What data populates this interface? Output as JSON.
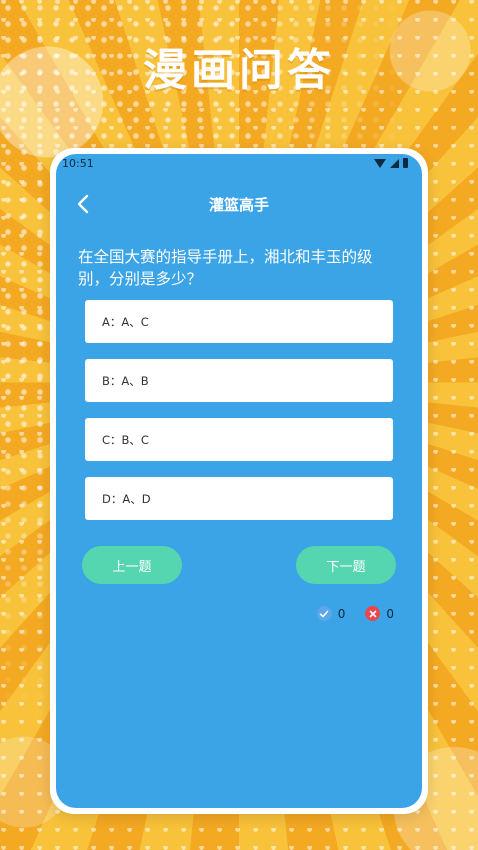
{
  "app_title": "漫画问答",
  "status_bar": {
    "time": "10:51"
  },
  "nav": {
    "title": "灌篮高手"
  },
  "question": "在全国大赛的指导手册上，湘北和丰玉的级别，分别是多少？",
  "options": [
    {
      "label": "A：A、C"
    },
    {
      "label": "B：A、B"
    },
    {
      "label": "C：B、C"
    },
    {
      "label": "D：A、D"
    }
  ],
  "buttons": {
    "prev": "上一题",
    "next": "下一题"
  },
  "scores": {
    "correct": "0",
    "wrong": "0"
  },
  "colors": {
    "background": "#f6b52a",
    "screen": "#3ba4e6",
    "button": "#55d6b1",
    "correct_icon": "#5aa6e8",
    "wrong_icon": "#e8474f"
  }
}
